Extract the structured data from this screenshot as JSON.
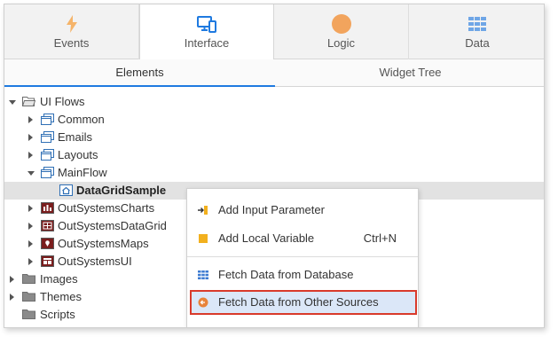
{
  "top_tabs": [
    {
      "label": "Events",
      "icon": "lightning-icon",
      "active": false
    },
    {
      "label": "Interface",
      "icon": "devices-icon",
      "active": true
    },
    {
      "label": "Logic",
      "icon": "logic-circle-icon",
      "active": false
    },
    {
      "label": "Data",
      "icon": "grid-icon",
      "active": false
    }
  ],
  "sub_tabs": [
    {
      "label": "Elements",
      "active": true
    },
    {
      "label": "Widget Tree",
      "active": false
    }
  ],
  "tree": {
    "ui_flows": "UI Flows",
    "common": "Common",
    "emails": "Emails",
    "layouts": "Layouts",
    "mainflow": "MainFlow",
    "datagridsample": "DataGridSample",
    "outsystemscharts": "OutSystemsCharts",
    "outsystemsdatagrid": "OutSystemsDataGrid",
    "outsystemsmaps": "OutSystemsMaps",
    "outsystemsui": "OutSystemsUI",
    "images": "Images",
    "themes": "Themes",
    "scripts": "Scripts"
  },
  "context_menu": {
    "add_input_parameter": "Add Input Parameter",
    "add_local_variable": "Add Local Variable",
    "add_local_variable_shortcut": "Ctrl+N",
    "fetch_data_from_database": "Fetch Data from Database",
    "fetch_data_from_other_sources": "Fetch Data from Other Sources"
  },
  "colors": {
    "accent": "#1f7ae0",
    "highlight_border": "#d93a2b",
    "highlight_fill": "#dbe7f8",
    "logic_orange": "#f2a45d",
    "events_orange": "#f5b46a"
  }
}
